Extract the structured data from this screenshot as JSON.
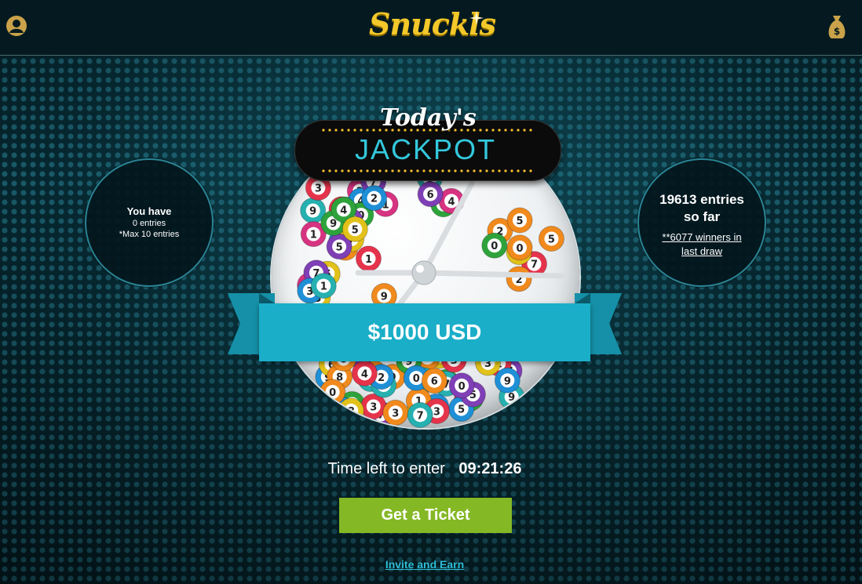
{
  "header": {
    "logo_text": "Snuckls",
    "icons": {
      "profile": "user-circle-icon",
      "wallet": "money-bag-icon"
    },
    "accent_color": "#f3c82a"
  },
  "entries_panel": {
    "heading": "You have",
    "count_text": "0 entries",
    "max_text": "*Max 10 entries"
  },
  "stats_panel": {
    "entries_line1": "19613 entries",
    "entries_line2": "so far",
    "winners_link_line1": "**6077 winners in",
    "winners_link_line2": "last draw"
  },
  "jackpot": {
    "title_small": "Today's",
    "title_big": "JACKPOT",
    "amount": "$1000 USD",
    "ribbon_color": "#1aaec8"
  },
  "timer": {
    "label": "Time left to enter",
    "value": "09:21:26"
  },
  "actions": {
    "ticket_button": "Get a Ticket",
    "ticket_color": "#85b825",
    "invite_link": "Invite and Earn"
  }
}
